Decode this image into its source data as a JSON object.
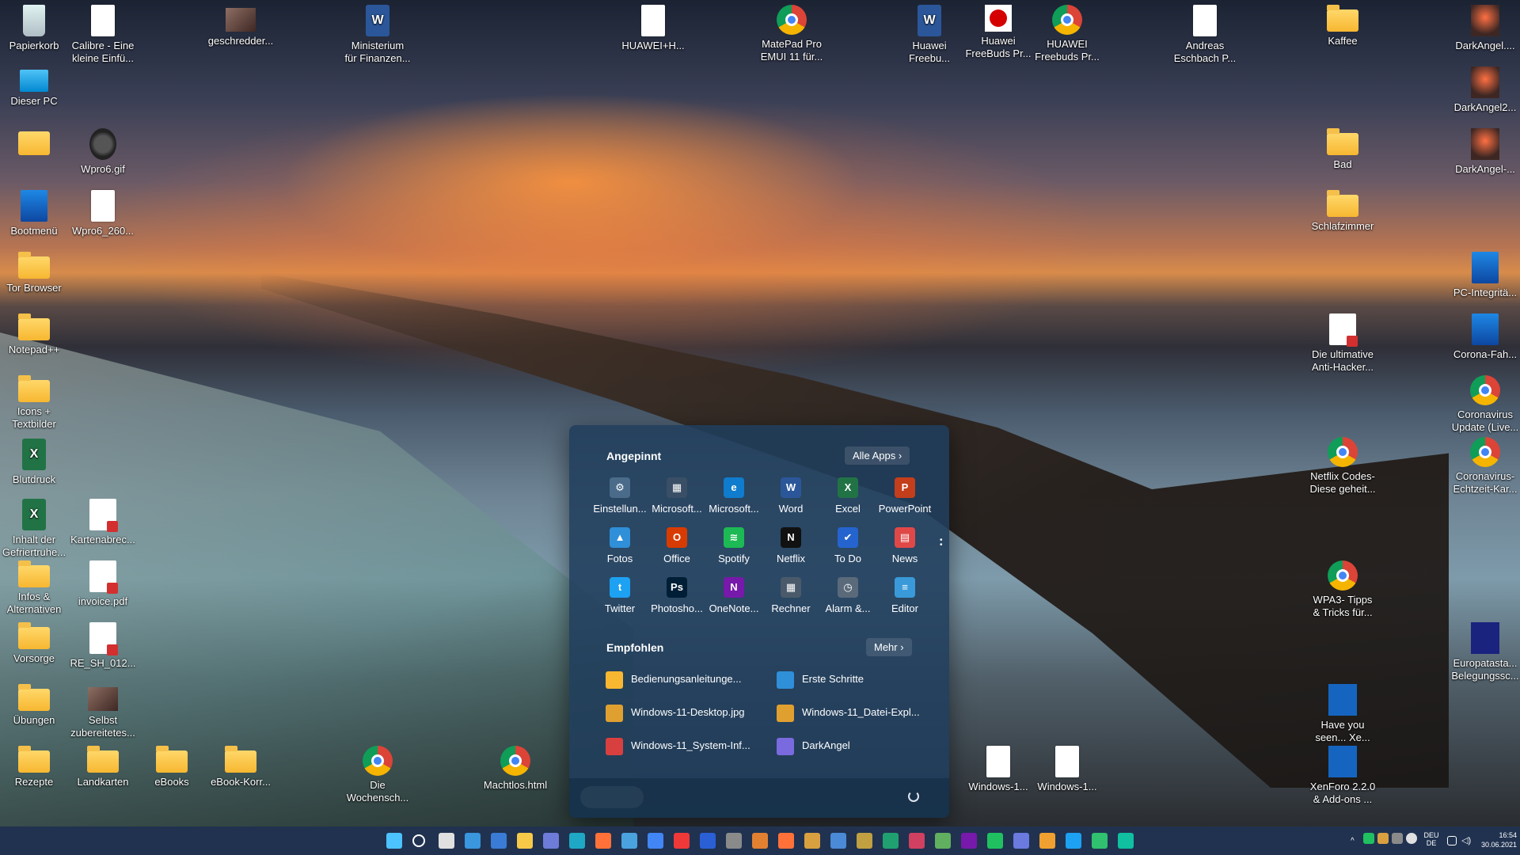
{
  "desktop": {
    "icons": [
      {
        "label": "Papierkorb",
        "icon": "recycle-bin-icon"
      },
      {
        "label": "Dieser PC",
        "icon": "computer-icon"
      },
      {
        "label": "",
        "icon": "user-folder-icon"
      },
      {
        "label": "Bootmenü",
        "icon": "app-icon"
      },
      {
        "label": "Tor Browser",
        "icon": "folder-icon"
      },
      {
        "label": "Notepad++",
        "icon": "folder-icon"
      },
      {
        "label": "Icons +\nTextbilder",
        "icon": "folder-icon"
      },
      {
        "label": "Blutdruck",
        "icon": "excel-icon"
      },
      {
        "label": "Inhalt der\nGefriertruhe...",
        "icon": "excel-icon"
      },
      {
        "label": "Infos &\nAlternativen",
        "icon": "folder-icon"
      },
      {
        "label": "Vorsorge",
        "icon": "folder-icon"
      },
      {
        "label": "Übungen",
        "icon": "folder-icon"
      },
      {
        "label": "Rezepte",
        "icon": "folder-icon"
      },
      {
        "label": "Calibre - Eine\nkleine Einfü...",
        "icon": "document-icon"
      },
      {
        "label": "Wpro6.gif",
        "icon": "watch-icon"
      },
      {
        "label": "Wpro6_260...",
        "icon": "document-icon"
      },
      {
        "label": "Kartenabrec...",
        "icon": "pdf-icon"
      },
      {
        "label": "invoice.pdf",
        "icon": "pdf-icon"
      },
      {
        "label": "RE_SH_012...",
        "icon": "pdf-icon"
      },
      {
        "label": "Selbst\nzubereitetes...",
        "icon": "photo-icon"
      },
      {
        "label": "Landkarten",
        "icon": "folder-icon"
      },
      {
        "label": "eBooks",
        "icon": "folder-icon"
      },
      {
        "label": "eBook-Korr...",
        "icon": "folder-icon"
      },
      {
        "label": "geschredder...",
        "icon": "photo-icon"
      },
      {
        "label": "Ministerium\nfür Finanzen...",
        "icon": "word-icon"
      },
      {
        "label": "Die\nWochensch...",
        "icon": "chrome-icon"
      },
      {
        "label": "Machtlos.html",
        "icon": "chrome-icon"
      },
      {
        "label": "HUAWEI+H...",
        "icon": "document-icon"
      },
      {
        "label": "MatePad Pro\nEMUI 11 für...",
        "icon": "chrome-icon"
      },
      {
        "label": "Huawei\nFreebu...",
        "icon": "word-icon"
      },
      {
        "label": "Huawei\nFreeBuds Pr...",
        "icon": "huawei-icon"
      },
      {
        "label": "HUAWEI\nFreebuds Pr...",
        "icon": "chrome-icon"
      },
      {
        "label": "Andreas\nEschbach P...",
        "icon": "document-icon"
      },
      {
        "label": "Windows-1...",
        "icon": "document-icon"
      },
      {
        "label": "Windows-1...",
        "icon": "document-icon"
      },
      {
        "label": "Kaffee",
        "icon": "folder-icon"
      },
      {
        "label": "Bad",
        "icon": "folder-icon"
      },
      {
        "label": "Schlafzimmer",
        "icon": "folder-icon"
      },
      {
        "label": "Die ultimative\nAnti-Hacker...",
        "icon": "pdf-icon"
      },
      {
        "label": "Netflix Codes-\nDiese geheit...",
        "icon": "chrome-icon"
      },
      {
        "label": "WPA3- Tipps\n& Tricks für...",
        "icon": "chrome-icon"
      },
      {
        "label": "Have you\nseen... Xe...",
        "icon": "xenforo-icon"
      },
      {
        "label": "XenForo 2.2.0\n& Add-ons ...",
        "icon": "xenforo-icon"
      },
      {
        "label": "DarkAngel....",
        "icon": "darkangel-icon"
      },
      {
        "label": "DarkAngel2...",
        "icon": "darkangel-icon"
      },
      {
        "label": "DarkAngel-...",
        "icon": "darkangel-icon"
      },
      {
        "label": "PC-Integritä...",
        "icon": "app-icon"
      },
      {
        "label": "Corona-Fah...",
        "icon": "app-icon"
      },
      {
        "label": "Coronavirus\nUpdate (Live...",
        "icon": "chrome-icon"
      },
      {
        "label": "Coronavirus-\nEchtzeit-Kar...",
        "icon": "chrome-icon"
      },
      {
        "label": "Europatasta...\nBelegungssc...",
        "icon": "keyboard-icon"
      }
    ]
  },
  "start": {
    "pinned_title": "Angepinnt",
    "all_apps": "Alle Apps  ›",
    "pinned": [
      {
        "label": "Einstellun...",
        "color": "#4a6b8a",
        "glyph": "⚙"
      },
      {
        "label": "Microsoft...",
        "color": "#3a4f66",
        "glyph": "▦"
      },
      {
        "label": "Microsoft...",
        "color": "#0f7ccd",
        "glyph": "e"
      },
      {
        "label": "Word",
        "color": "#2b579a",
        "glyph": "W"
      },
      {
        "label": "Excel",
        "color": "#217346",
        "glyph": "X"
      },
      {
        "label": "PowerPoint",
        "color": "#c43e1c",
        "glyph": "P"
      },
      {
        "label": "Fotos",
        "color": "#2f8fd8",
        "glyph": "▲"
      },
      {
        "label": "Office",
        "color": "#d83b01",
        "glyph": "O"
      },
      {
        "label": "Spotify",
        "color": "#1db954",
        "glyph": "≋"
      },
      {
        "label": "Netflix",
        "color": "#111111",
        "glyph": "N"
      },
      {
        "label": "To Do",
        "color": "#2564cf",
        "glyph": "✔"
      },
      {
        "label": "News",
        "color": "#e04848",
        "glyph": "▤"
      },
      {
        "label": "Twitter",
        "color": "#1da1f2",
        "glyph": "t"
      },
      {
        "label": "Photosho...",
        "color": "#001e36",
        "glyph": "Ps"
      },
      {
        "label": "OneNote...",
        "color": "#7719aa",
        "glyph": "N"
      },
      {
        "label": "Rechner",
        "color": "#4a5a6a",
        "glyph": "▦"
      },
      {
        "label": "Alarm &...",
        "color": "#5a6a7a",
        "glyph": "◷"
      },
      {
        "label": "Editor",
        "color": "#3a9ad9",
        "glyph": "≡"
      }
    ],
    "rec_title": "Empfohlen",
    "more": "Mehr  ›",
    "recommended": [
      {
        "label": "Bedienungsanleitunge...",
        "color": "#f7b731"
      },
      {
        "label": "Erste Schritte",
        "color": "#2f8fd8"
      },
      {
        "label": "Windows-11-Desktop.jpg",
        "color": "#e0a030"
      },
      {
        "label": "Windows-11_Datei-Expl...",
        "color": "#e0a030"
      },
      {
        "label": "Windows-11_System-Inf...",
        "color": "#d84040"
      },
      {
        "label": "DarkAngel",
        "color": "#7a6adf"
      }
    ],
    "power_icon": "power-icon"
  },
  "taskbar": {
    "apps": [
      {
        "name": "start-icon",
        "color": "#4cc2ff"
      },
      {
        "name": "search-icon",
        "color": "#ffffff"
      },
      {
        "name": "task-view-icon",
        "color": "#e0e0e0"
      },
      {
        "name": "widgets-icon",
        "color": "#3a96dd"
      },
      {
        "name": "store-icon",
        "color": "#3a7bd5"
      },
      {
        "name": "explorer-icon",
        "color": "#f7c948"
      },
      {
        "name": "chat-icon",
        "color": "#6f7bd8"
      },
      {
        "name": "edge-icon",
        "color": "#1ea8c5"
      },
      {
        "name": "firefox-icon",
        "color": "#ff7139"
      },
      {
        "name": "app-icon",
        "color": "#4aa3df"
      },
      {
        "name": "chrome-icon",
        "color": "#4285f4"
      },
      {
        "name": "vivaldi-icon",
        "color": "#ef3939"
      },
      {
        "name": "app-icon",
        "color": "#2a5fd6"
      },
      {
        "name": "app-icon",
        "color": "#8a8a8a"
      },
      {
        "name": "app-icon",
        "color": "#e08030"
      },
      {
        "name": "app-icon",
        "color": "#ff7139"
      },
      {
        "name": "winamp-icon",
        "color": "#d9a040"
      },
      {
        "name": "app-icon",
        "color": "#4a8ad6"
      },
      {
        "name": "app-icon",
        "color": "#c0a040"
      },
      {
        "name": "app-icon",
        "color": "#20a070"
      },
      {
        "name": "app-icon",
        "color": "#d04060"
      },
      {
        "name": "notepad-icon",
        "color": "#60b060"
      },
      {
        "name": "onenote-icon",
        "color": "#7719aa"
      },
      {
        "name": "app-icon",
        "color": "#20c060"
      },
      {
        "name": "app-icon",
        "color": "#6a7adf"
      },
      {
        "name": "chart-icon",
        "color": "#f0a030"
      },
      {
        "name": "twitter-icon",
        "color": "#1da1f2"
      },
      {
        "name": "app-icon",
        "color": "#30c070"
      },
      {
        "name": "app-icon",
        "color": "#10c0a0"
      }
    ],
    "lang": "DEU\nDE",
    "time": "16:54",
    "date": "30.06.2021"
  }
}
